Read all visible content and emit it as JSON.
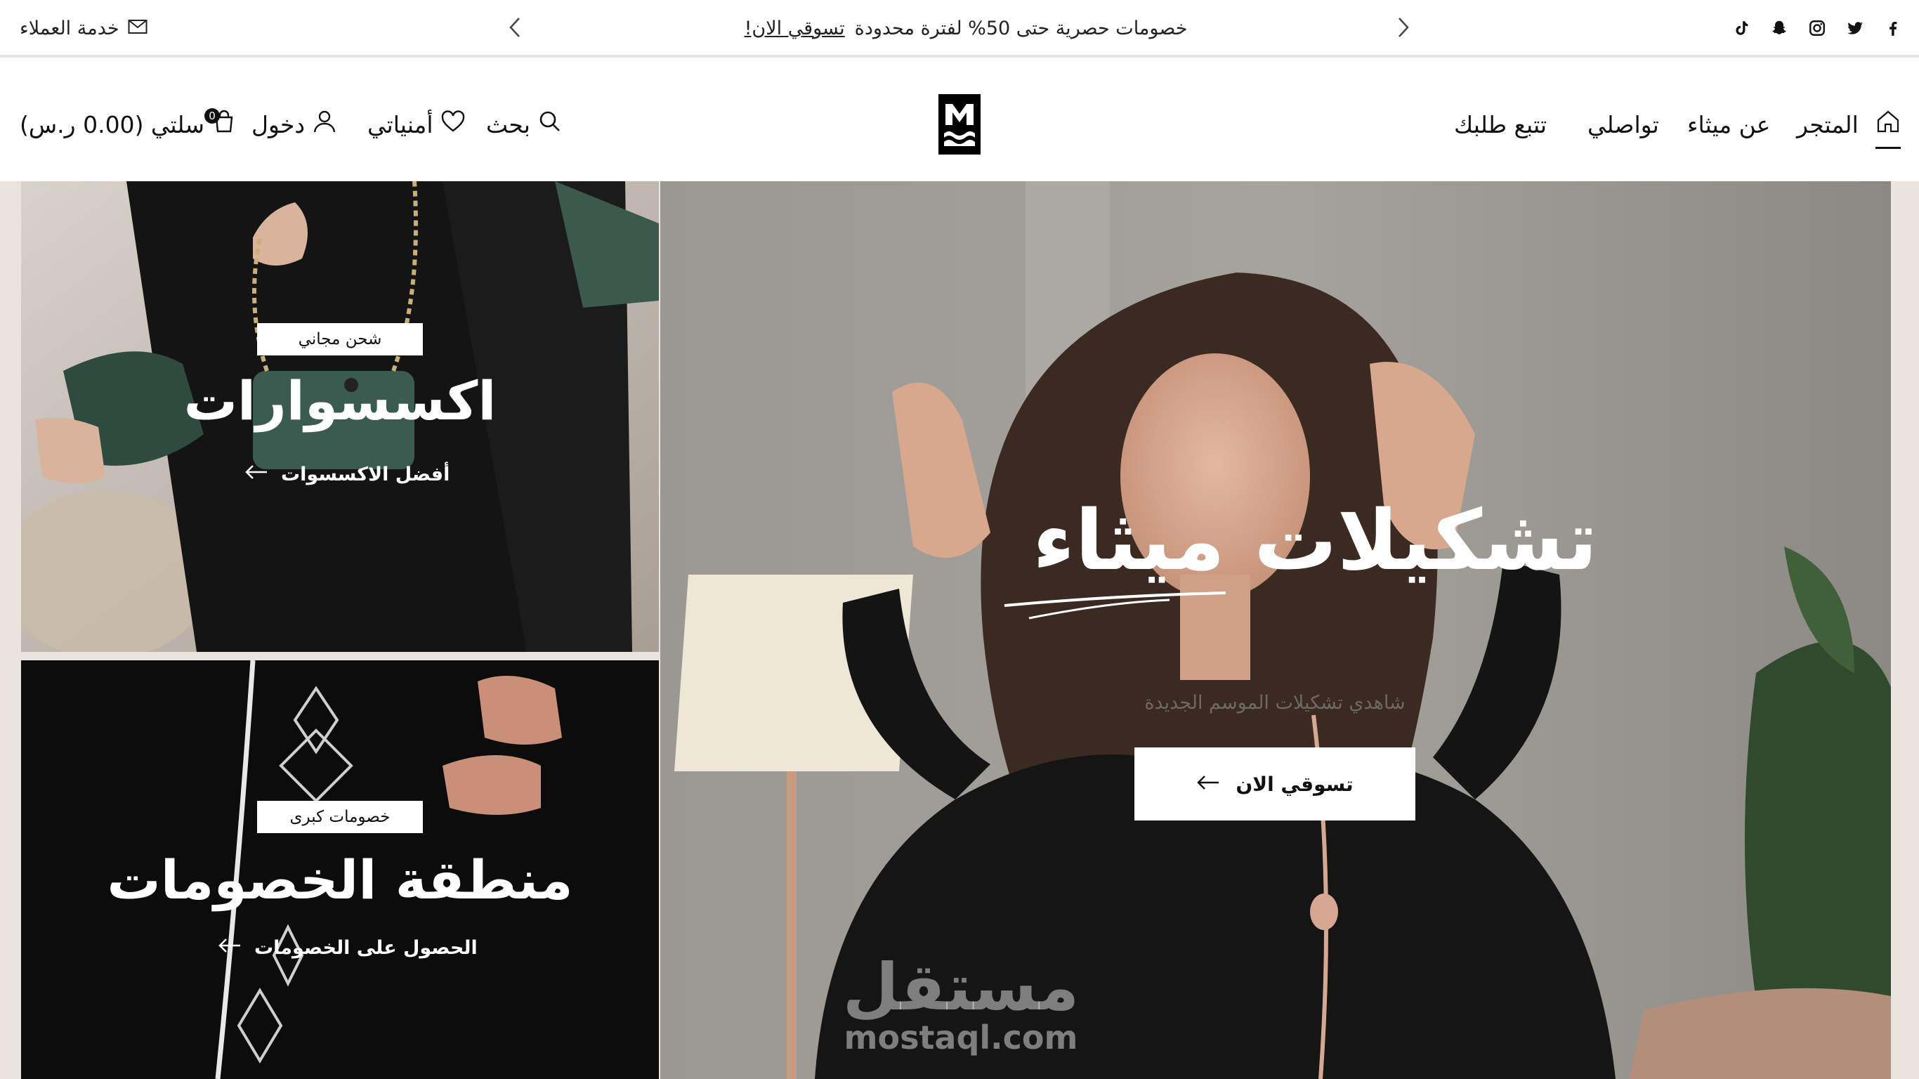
{
  "topbar": {
    "promo_text": "خصومات حصرية حتى 50% لفترة محدودة",
    "promo_link": "تسوقي الان!",
    "customer_service": "خدمة العملاء",
    "social_icons": [
      "facebook-icon",
      "twitter-icon",
      "instagram-icon",
      "snapchat-icon",
      "tiktok-icon"
    ]
  },
  "header": {
    "nav": {
      "store": "المتجر",
      "about": "عن ميثاء",
      "contact": "تواصلي",
      "track": "تتبع طلبك"
    },
    "utils": {
      "search": "بحث",
      "wishlist": "أمنياتي",
      "login": "دخول",
      "cart": "سلتي (0.00 ر.س)",
      "cart_count": "0"
    }
  },
  "panels": {
    "accessories": {
      "badge": "شحن مجاني",
      "title": "اكسسوارات",
      "link": "أفضل الاكسسوات"
    },
    "discounts": {
      "badge": "خصومات كبرى",
      "title": "منطقة الخصومات",
      "link": "الحصول على الخصومات"
    },
    "hero": {
      "title": "تشكيلات ميثاء",
      "subtitle": "شاهدي تشكيلات الموسم الجديدة",
      "button": "تسوقي الان"
    }
  },
  "watermark": {
    "arabic": "مستقل",
    "latin": "mostaql.com"
  },
  "colors": {
    "accent": "#111111",
    "background": "#ebe3dd",
    "white": "#ffffff"
  }
}
